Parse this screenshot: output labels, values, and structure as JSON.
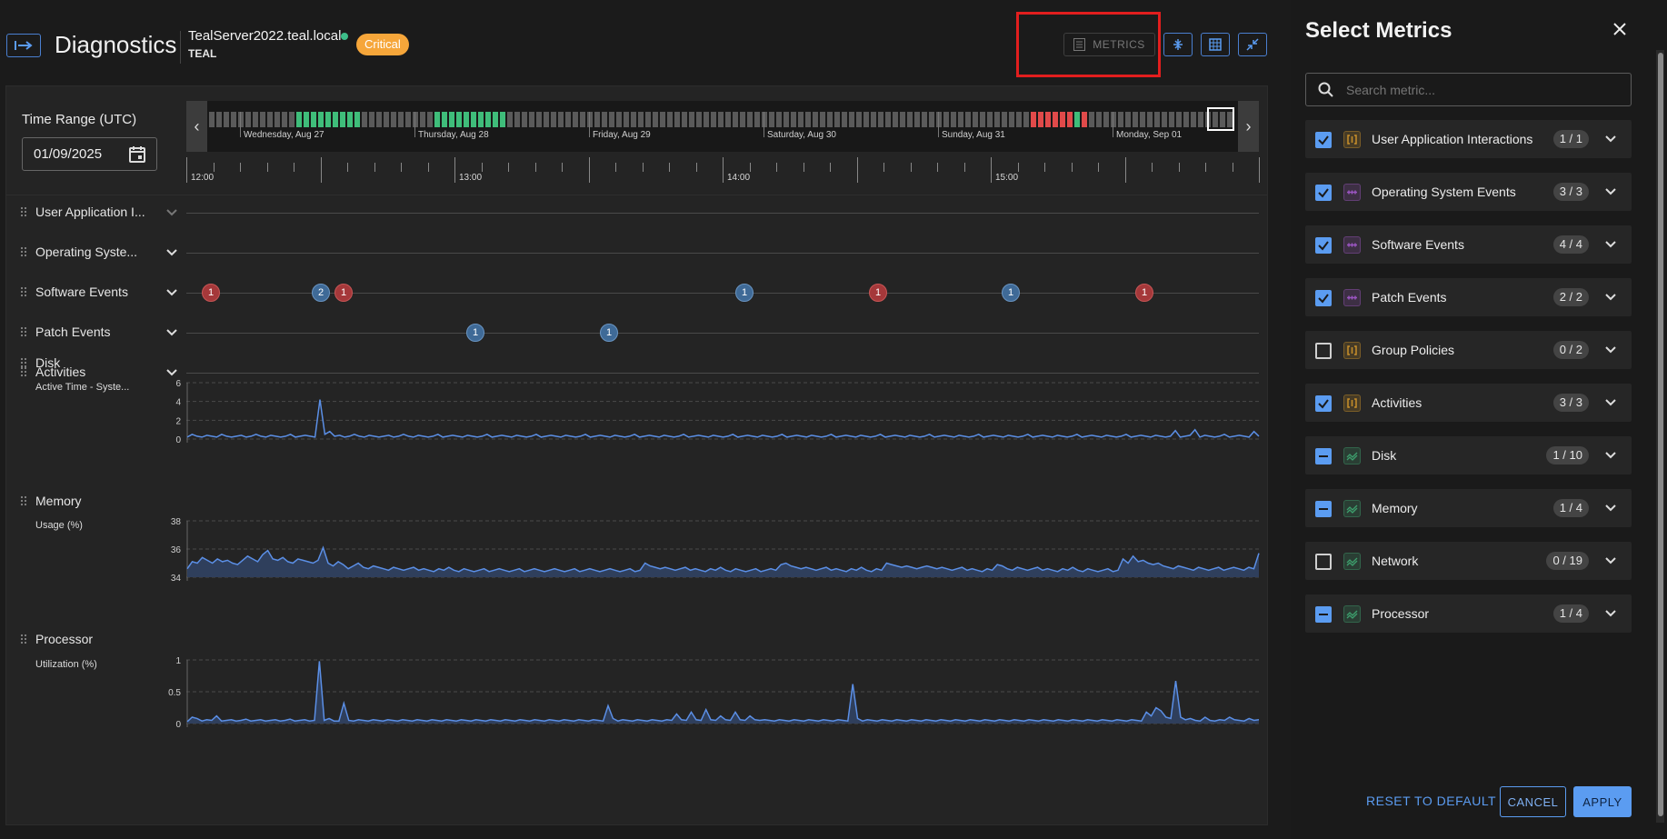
{
  "header": {
    "title": "Diagnostics",
    "host": "TealServer2022.teal.local",
    "org": "TEAL",
    "status_badge": "Critical",
    "metrics_button": "METRICS"
  },
  "time_range": {
    "label": "Time Range (UTC)",
    "date_value": "01/09/2025",
    "days": [
      "Wednesday, Aug 27",
      "Thursday, Aug 28",
      "Friday, Aug 29",
      "Saturday, Aug 30",
      "Sunday, Aug 31",
      "Monday, Sep 01"
    ],
    "hours": [
      "12:00",
      "13:00",
      "14:00",
      "15:00"
    ]
  },
  "rows": {
    "user_app": "User Application I...",
    "os_events": "Operating Syste...",
    "software_events": "Software Events",
    "patch_events": "Patch Events",
    "activities": "Activities",
    "disk": "Disk",
    "memory": "Memory",
    "processor": "Processor"
  },
  "software_event_markers": [
    "1",
    "2",
    "1",
    "1",
    "1",
    "1",
    "1"
  ],
  "patch_event_markers": [
    "1",
    "1"
  ],
  "charts": {
    "disk": {
      "label": "Active Time - Syste...",
      "yticks": [
        "6",
        "4",
        "2",
        "0"
      ],
      "ylim": [
        0,
        6
      ]
    },
    "memory": {
      "label": "Usage (%)",
      "yticks": [
        "38",
        "36",
        "34"
      ],
      "ylim": [
        34,
        38
      ]
    },
    "processor": {
      "label": "Utilization (%)",
      "yticks": [
        "1",
        "0.5",
        "0"
      ],
      "ylim": [
        0,
        1
      ]
    }
  },
  "chart_data": [
    {
      "type": "line",
      "ylabel": "Active Time - Syste...",
      "ylim": [
        0,
        6
      ],
      "grid": true,
      "series": [
        {
          "values": [
            0.2,
            0.5,
            0.3,
            0.2,
            0.4,
            0.3,
            0.2,
            0.5,
            0.3,
            0.2,
            0.3,
            0.4,
            0.2,
            0.3,
            0.5,
            0.3,
            0.2,
            0.4,
            0.3,
            0.2,
            0.3,
            0.5,
            0.2,
            0.3,
            0.4,
            0.3,
            0.2,
            4.2,
            0.5,
            0.8,
            0.3,
            0.4,
            0.2,
            0.3,
            0.5,
            0.3,
            0.2,
            0.4,
            0.3,
            0.2,
            0.3,
            0.4,
            0.2,
            0.3,
            0.5,
            0.3,
            0.2,
            0.4,
            0.3,
            0.2,
            0.3,
            0.5,
            0.2,
            0.3,
            0.4,
            0.3,
            0.2,
            0.4,
            0.3,
            0.2,
            0.3,
            0.5,
            0.2,
            0.3,
            0.4,
            0.3,
            0.2,
            0.4,
            0.3,
            0.2,
            0.3,
            0.5,
            0.2,
            0.3,
            0.4,
            0.3,
            0.2,
            0.4,
            0.3,
            0.2,
            0.3,
            0.5,
            0.2,
            0.3,
            0.4,
            0.3,
            0.2,
            0.4,
            0.3,
            0.2,
            0.3,
            0.5,
            0.2,
            0.3,
            0.4,
            0.3,
            0.2,
            0.4,
            0.3,
            0.2,
            0.3,
            0.5,
            0.2,
            0.3,
            0.4,
            0.3,
            0.2,
            0.4,
            0.3,
            0.2,
            0.3,
            0.5,
            0.2,
            0.3,
            0.4,
            0.3,
            0.2,
            0.4,
            0.3,
            0.2,
            0.3,
            0.5,
            0.2,
            0.3,
            0.4,
            0.3,
            0.2,
            0.4,
            0.3,
            0.2,
            0.3,
            0.5,
            0.2,
            0.3,
            0.4,
            0.3,
            0.2,
            0.4,
            0.3,
            0.2,
            0.3,
            0.5,
            0.2,
            0.3,
            0.4,
            0.3,
            0.2,
            0.4,
            0.3,
            0.2,
            0.3,
            0.5,
            0.2,
            0.3,
            0.4,
            0.3,
            0.2,
            0.4,
            0.3,
            0.2,
            0.3,
            0.5,
            0.2,
            0.3,
            0.4,
            0.3,
            0.2,
            0.4,
            0.3,
            0.2,
            0.3,
            0.5,
            0.2,
            0.3,
            0.4,
            0.3,
            0.2,
            0.4,
            0.3,
            0.2,
            0.3,
            0.5,
            0.2,
            0.3,
            0.4,
            0.3,
            0.2,
            0.4,
            0.3,
            0.2,
            0.3,
            0.5,
            0.2,
            0.3,
            0.4,
            0.3,
            0.2,
            0.4,
            0.3,
            0.2,
            0.3,
            0.9,
            0.2,
            0.3,
            0.4,
            1.0,
            0.2,
            0.4,
            0.3,
            0.2,
            0.3,
            0.5,
            0.2,
            0.3,
            0.4,
            0.3,
            0.2,
            0.8,
            0.3
          ]
        }
      ]
    },
    {
      "type": "area",
      "ylabel": "Usage (%)",
      "ylim": [
        34,
        38
      ],
      "grid": true,
      "series": [
        {
          "values": [
            34.6,
            35.1,
            35.0,
            35.4,
            35.2,
            35.0,
            35.3,
            35.1,
            35.2,
            35.0,
            34.9,
            35.2,
            35.5,
            35.3,
            35.1,
            35.6,
            35.9,
            35.3,
            35.2,
            35.4,
            35.1,
            35.0,
            35.3,
            35.2,
            35.1,
            35.0,
            35.2,
            36.1,
            35.0,
            34.8,
            35.1,
            34.9,
            34.6,
            34.8,
            35.0,
            34.7,
            34.6,
            34.8,
            34.7,
            34.6,
            34.5,
            34.7,
            34.6,
            34.5,
            34.6,
            34.7,
            34.5,
            34.6,
            34.5,
            34.4,
            34.6,
            34.5,
            34.7,
            34.5,
            34.4,
            34.6,
            34.5,
            34.4,
            34.5,
            34.6,
            34.4,
            34.5,
            34.6,
            34.5,
            34.4,
            34.5,
            34.6,
            34.4,
            34.5,
            34.6,
            34.5,
            34.4,
            34.5,
            34.6,
            34.5,
            34.4,
            34.5,
            34.6,
            34.4,
            34.5,
            34.6,
            34.5,
            34.4,
            34.5,
            34.6,
            34.5,
            34.4,
            34.5,
            34.6,
            34.4,
            34.5,
            35.0,
            34.8,
            34.7,
            34.6,
            34.7,
            34.6,
            34.5,
            34.6,
            34.7,
            34.5,
            34.6,
            34.5,
            34.4,
            34.6,
            34.5,
            34.7,
            34.5,
            34.4,
            34.6,
            34.5,
            34.4,
            34.5,
            34.6,
            34.4,
            34.5,
            34.6,
            34.5,
            34.9,
            35.0,
            34.8,
            34.7,
            34.6,
            34.7,
            34.6,
            34.5,
            34.6,
            34.7,
            34.5,
            34.6,
            34.5,
            34.4,
            34.6,
            34.5,
            34.7,
            34.5,
            34.4,
            34.6,
            34.5,
            35.0,
            34.9,
            34.8,
            34.7,
            34.8,
            34.7,
            34.6,
            34.7,
            34.8,
            34.7,
            34.6,
            34.7,
            34.6,
            34.5,
            34.6,
            34.7,
            34.5,
            34.6,
            34.5,
            34.4,
            34.6,
            34.5,
            34.9,
            34.8,
            34.6,
            34.5,
            34.7,
            34.6,
            34.5,
            34.6,
            34.7,
            34.5,
            34.6,
            34.5,
            34.4,
            34.6,
            34.5,
            34.7,
            34.5,
            34.4,
            34.6,
            34.5,
            34.4,
            34.5,
            34.6,
            34.4,
            34.5,
            35.3,
            35.0,
            35.5,
            35.1,
            35.2,
            35.0,
            34.9,
            35.0,
            34.8,
            34.7,
            34.6,
            34.8,
            34.7,
            34.6,
            34.5,
            34.7,
            34.6,
            34.5,
            34.6,
            34.7,
            34.5,
            34.6,
            34.7,
            34.6,
            34.5,
            34.7,
            34.6,
            35.7
          ]
        }
      ]
    },
    {
      "type": "area",
      "ylabel": "Utilization (%)",
      "ylim": [
        0,
        1
      ],
      "grid": true,
      "series": [
        {
          "values": [
            0.03,
            0.1,
            0.08,
            0.04,
            0.06,
            0.05,
            0.12,
            0.04,
            0.05,
            0.06,
            0.04,
            0.05,
            0.07,
            0.04,
            0.05,
            0.06,
            0.04,
            0.05,
            0.06,
            0.04,
            0.05,
            0.07,
            0.04,
            0.05,
            0.06,
            0.04,
            0.05,
            0.98,
            0.05,
            0.08,
            0.04,
            0.04,
            0.32,
            0.05,
            0.04,
            0.06,
            0.05,
            0.04,
            0.06,
            0.05,
            0.04,
            0.06,
            0.05,
            0.04,
            0.06,
            0.05,
            0.04,
            0.06,
            0.05,
            0.04,
            0.06,
            0.05,
            0.04,
            0.06,
            0.05,
            0.04,
            0.06,
            0.05,
            0.04,
            0.06,
            0.05,
            0.04,
            0.06,
            0.05,
            0.04,
            0.06,
            0.05,
            0.04,
            0.06,
            0.05,
            0.04,
            0.06,
            0.05,
            0.04,
            0.06,
            0.05,
            0.04,
            0.06,
            0.05,
            0.04,
            0.06,
            0.05,
            0.04,
            0.06,
            0.05,
            0.04,
            0.28,
            0.08,
            0.04,
            0.06,
            0.05,
            0.04,
            0.06,
            0.05,
            0.04,
            0.06,
            0.05,
            0.04,
            0.06,
            0.05,
            0.15,
            0.06,
            0.05,
            0.18,
            0.06,
            0.05,
            0.22,
            0.06,
            0.05,
            0.12,
            0.06,
            0.05,
            0.18,
            0.06,
            0.05,
            0.12,
            0.06,
            0.05,
            0.06,
            0.05,
            0.04,
            0.06,
            0.05,
            0.04,
            0.06,
            0.05,
            0.04,
            0.06,
            0.05,
            0.04,
            0.06,
            0.05,
            0.04,
            0.06,
            0.05,
            0.04,
            0.62,
            0.08,
            0.04,
            0.06,
            0.05,
            0.04,
            0.06,
            0.05,
            0.04,
            0.06,
            0.05,
            0.04,
            0.06,
            0.05,
            0.04,
            0.06,
            0.05,
            0.04,
            0.06,
            0.05,
            0.04,
            0.06,
            0.05,
            0.04,
            0.06,
            0.05,
            0.04,
            0.06,
            0.05,
            0.04,
            0.06,
            0.05,
            0.04,
            0.06,
            0.05,
            0.04,
            0.06,
            0.05,
            0.04,
            0.06,
            0.05,
            0.04,
            0.06,
            0.05,
            0.04,
            0.06,
            0.05,
            0.04,
            0.06,
            0.05,
            0.04,
            0.06,
            0.05,
            0.04,
            0.06,
            0.05,
            0.04,
            0.06,
            0.05,
            0.04,
            0.18,
            0.12,
            0.25,
            0.2,
            0.1,
            0.08,
            0.67,
            0.1,
            0.06,
            0.08,
            0.05,
            0.04,
            0.1,
            0.05,
            0.04,
            0.06,
            0.05,
            0.1,
            0.06,
            0.05,
            0.04,
            0.08,
            0.05,
            0.06
          ]
        }
      ]
    }
  ],
  "side_panel": {
    "title": "Select Metrics",
    "search_placeholder": "Search metric...",
    "metrics": [
      {
        "name": "User Application Interactions",
        "count": "1 / 1",
        "state": "checked",
        "icon": "brackets-icon",
        "color": "#c8902a"
      },
      {
        "name": "Operating System Events",
        "count": "3 / 3",
        "state": "checked",
        "icon": "events-icon",
        "color": "#9a55c0"
      },
      {
        "name": "Software Events",
        "count": "4 / 4",
        "state": "checked",
        "icon": "events-icon",
        "color": "#9a55c0"
      },
      {
        "name": "Patch Events",
        "count": "2 / 2",
        "state": "checked",
        "icon": "events-icon",
        "color": "#9a55c0"
      },
      {
        "name": "Group Policies",
        "count": "0 / 2",
        "state": "empty",
        "icon": "brackets-icon",
        "color": "#c8902a"
      },
      {
        "name": "Activities",
        "count": "3 / 3",
        "state": "checked",
        "icon": "brackets-icon",
        "color": "#c8902a"
      },
      {
        "name": "Disk",
        "count": "1 / 10",
        "state": "partial",
        "icon": "wave-icon",
        "color": "#3ea06e"
      },
      {
        "name": "Memory",
        "count": "1 / 4",
        "state": "partial",
        "icon": "wave-icon",
        "color": "#3ea06e"
      },
      {
        "name": "Network",
        "count": "0 / 19",
        "state": "empty",
        "icon": "wave-icon",
        "color": "#3ea06e"
      },
      {
        "name": "Processor",
        "count": "1 / 4",
        "state": "partial",
        "icon": "wave-icon",
        "color": "#3ea06e"
      }
    ],
    "reset_label": "RESET TO DEFAULT",
    "cancel_label": "CANCEL",
    "apply_label": "APPLY"
  },
  "colors": {
    "accent": "#5b9cf1",
    "critical": "#f6a63a",
    "healthy": "#3dbd8a",
    "error": "#e14a4a",
    "line": "#5b8fe6"
  }
}
